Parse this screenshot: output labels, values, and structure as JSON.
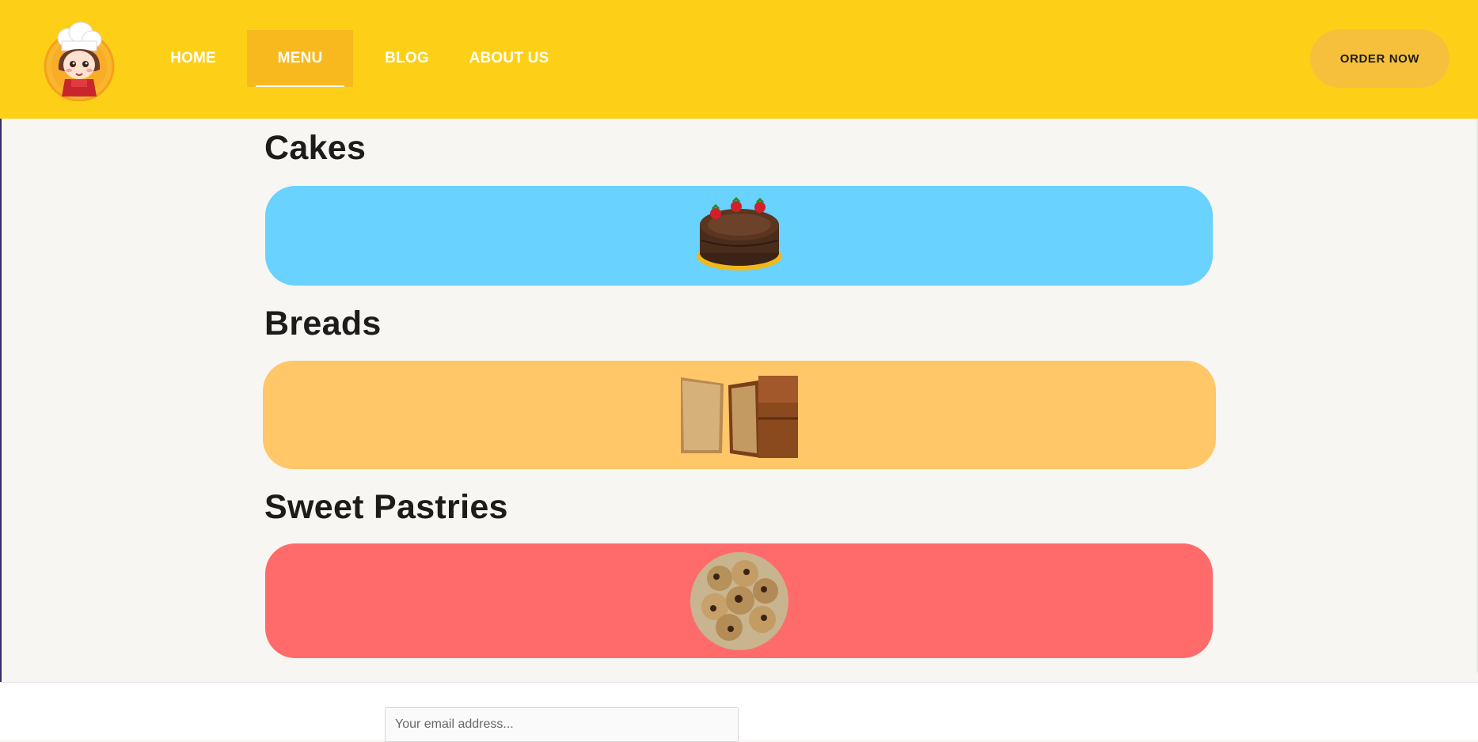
{
  "header": {
    "nav": [
      {
        "label": "HOME"
      },
      {
        "label": "MENU",
        "active": true
      },
      {
        "label": "BLOG"
      },
      {
        "label": "ABOUT US"
      }
    ],
    "order_button": "ORDER NOW",
    "logo_icon": "chef-girl-logo",
    "colors": {
      "background": "#fdd017",
      "active_nav": "#f8b91f",
      "order_button": "#f7c03c"
    }
  },
  "sections": [
    {
      "title": "Cakes",
      "color": "#69d2ff",
      "image_icon": "chocolate-cake-image"
    },
    {
      "title": "Breads",
      "color": "#ffc768",
      "image_icon": "banana-bread-image"
    },
    {
      "title": "Sweet Pastries",
      "color": "#ff6b6b",
      "image_icon": "cookies-image"
    }
  ],
  "footer": {
    "email_placeholder": "Your email address..."
  }
}
